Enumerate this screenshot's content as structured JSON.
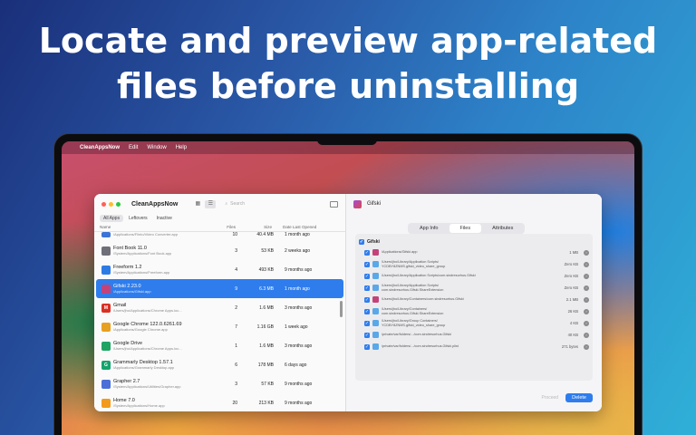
{
  "headline": {
    "line1": "Locate and preview app-related",
    "line2": "files before uninstalling"
  },
  "menubar": {
    "apple": "",
    "app_name": "CleanAppsNow",
    "items": [
      "Edit",
      "Window",
      "Help"
    ]
  },
  "window": {
    "title": "CleanAppsNow",
    "search_placeholder": "Search",
    "filters": [
      "All Apps",
      "Leftovers",
      "Inactive"
    ],
    "columns": {
      "name": "Name",
      "files": "Files",
      "size": "Size",
      "date": "Date Last Opened"
    },
    "apps": [
      {
        "name": "",
        "path": "/Applications/Flinto/Video Converter.app",
        "files": "10",
        "size": "40.4 MB",
        "date": "1 month ago",
        "icon_color": "#3b74d8",
        "partial": true
      },
      {
        "name": "Font Book 11.0",
        "path": "/System/Applications/Font Book.app",
        "files": "3",
        "size": "53 KB",
        "date": "2 weeks ago",
        "icon_color": "#6f6f78"
      },
      {
        "name": "Freeform 1.2",
        "path": "/System/Applications/Freeform.app",
        "files": "4",
        "size": "493 KB",
        "date": "9 months ago",
        "icon_color": "#2c7be5"
      },
      {
        "name": "Gifski 2.23.0",
        "path": "/Applications/Gifski.app",
        "files": "9",
        "size": "6.3 MB",
        "date": "1 month ago",
        "icon_color": "#c2437a",
        "selected": true
      },
      {
        "name": "Gmail",
        "path": "/Users/jho/Applications/Chrome Apps.loc...",
        "files": "2",
        "size": "1.6 MB",
        "date": "3 months ago",
        "icon_color": "#d93025",
        "icon_letter": "M"
      },
      {
        "name": "Google Chrome 122.0.6261.69",
        "path": "/Applications/Google Chrome.app",
        "files": "7",
        "size": "1.16 GB",
        "date": "1 week ago",
        "icon_color": "#e8a020"
      },
      {
        "name": "Google Drive",
        "path": "/Users/jho/Applications/Chrome Apps.loc...",
        "files": "1",
        "size": "1.6 MB",
        "date": "3 months ago",
        "icon_color": "#1fa463"
      },
      {
        "name": "Grammarly Desktop 1.57.1",
        "path": "/Applications/Grammarly Desktop.app",
        "files": "6",
        "size": "178 MB",
        "date": "6 days ago",
        "icon_color": "#15a36e",
        "icon_letter": "G"
      },
      {
        "name": "Grapher 2.7",
        "path": "/System/Applications/Utilities/Grapher.app",
        "files": "3",
        "size": "57 KB",
        "date": "9 months ago",
        "icon_color": "#4b6fd8"
      },
      {
        "name": "Home 7.0",
        "path": "/System/Applications/Home.app",
        "files": "20",
        "size": "213 KB",
        "date": "9 months ago",
        "icon_color": "#f29a1e"
      }
    ]
  },
  "detail": {
    "app_name": "Gifski",
    "tabs": [
      "App Info",
      "Files",
      "Attributes"
    ],
    "active_tab": "Files",
    "root_label": "Gifski",
    "files": [
      {
        "path": "/Applications/Gifski.app",
        "size": "1 MB",
        "icon_color": "#c2437a"
      },
      {
        "path": "/Users/jho/Library/Application Scripts/\nYCDBY8ZNMS.gifski_video_share_group",
        "size": "Zero KB",
        "icon_color": "#5aa8e8"
      },
      {
        "path": "/Users/jho/Library/Application Scripts/com.sindresorhus.Gifski",
        "size": "Zero KB",
        "icon_color": "#5aa8e8"
      },
      {
        "path": "/Users/jho/Library/Application Scripts/\ncom.sindresorhus.Gifski.ShareExtension",
        "size": "Zero KB",
        "icon_color": "#5aa8e8"
      },
      {
        "path": "/Users/jho/Library/Containers/com.sindresorhus.Gifski",
        "size": "2.1 MB",
        "icon_color": "#c2437a"
      },
      {
        "path": "/Users/jho/Library/Containers/\ncom.sindresorhus.Gifski.ShareExtension",
        "size": "26 KB",
        "icon_color": "#5aa8e8"
      },
      {
        "path": "/Users/jho/Library/Group Containers/\nYCDBY8ZNMS.gifski_video_share_group",
        "size": "4 KB",
        "icon_color": "#5aa8e8"
      },
      {
        "path": "/private/var/folders/.../com.sindresorhus.Gifski",
        "size": "40 KB",
        "icon_color": "#5aa8e8"
      },
      {
        "path": "/private/var/folders/.../com.sindresorhus.Gifski.plist",
        "size": "271 bytes",
        "icon_color": "#5aa8e8"
      }
    ],
    "secondary_button": "Proceed",
    "primary_button": "Delete"
  }
}
